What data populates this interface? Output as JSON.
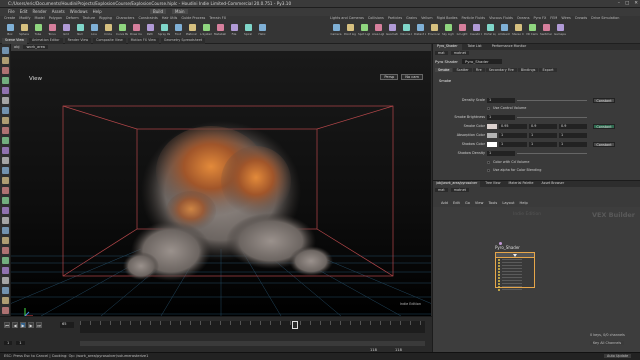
{
  "window": {
    "title": "C:/Users/eric/Documents/HoudiniProjects/ExplosionCourse/ExplosionCourse.hiplc - Houdini Indie Limited-Commercial 20.0.751 - Py3.10",
    "min_glyph": "–",
    "max_glyph": "□",
    "close_glyph": "✕"
  },
  "menubar": {
    "items": [
      "File",
      "Edit",
      "Render",
      "Assets",
      "Windows",
      "Help"
    ],
    "build_label": "Build",
    "desktop_label": "Main"
  },
  "shelf": {
    "left_tabs": [
      "Create",
      "Modify",
      "Model",
      "Polygon",
      "Deform",
      "Texture",
      "Rigging",
      "Characters",
      "Constraints",
      "Hair Utils",
      "Guide Process",
      "Terrain FX",
      "Simple FX",
      "Volume"
    ],
    "right_tabs": [
      "Lights and Cameras",
      "Collisions",
      "Particles",
      "Grains",
      "Vellum",
      "Rigid Bodies",
      "Particle Fluids",
      "Viscous Fluids",
      "Oceans",
      "Pyro FX",
      "FEM",
      "Wires",
      "Crowds",
      "Drive Simulation"
    ],
    "left_tools": [
      "Box",
      "Sphere",
      "Tube",
      "Torus",
      "Grid",
      "Null",
      "Line",
      "Circle",
      "Curve Bezier",
      "Draw Curve",
      "Path",
      "Spray Paint",
      "Font",
      "Platonic Solids",
      "L-System",
      "Metaball",
      "File",
      "Spiral",
      "Helix"
    ],
    "right_tools": [
      "Camera",
      "Point Light",
      "Spot Light",
      "Area Light",
      "Geometry Light",
      "Volume Light",
      "Distant Light",
      "Environment Light",
      "Sky Light",
      "GI Light",
      "Caustic Light",
      "Portal Light",
      "Ambient Light",
      "Stereo Camera",
      "VR Camera",
      "Switcher",
      "Gamepad Camera"
    ],
    "pane_tabs": [
      "Scene View",
      "Animation Editor",
      "Render View",
      "Composite View",
      "Motion FX View",
      "Geometry Spreadsheet"
    ]
  },
  "viewport": {
    "path_root": "obj",
    "path_node": "work_area",
    "label": "View",
    "persp_button": "Persp",
    "cam_button": "No cam",
    "footer": "Indie Edition"
  },
  "timeline": {
    "frame": "65",
    "start": "1",
    "end_field": "1",
    "range_start": "118",
    "range_end": "118",
    "keys_label": "0 keys, 0/0 channels",
    "key_all_label": "Key All Channels",
    "auto_update": "Auto Update"
  },
  "status": {
    "text": "ESC: Press Esc to Cancel | Cooking: Op: /work_area/pyrosolver/volumerasterize1"
  },
  "param_pane": {
    "tabs": [
      "Pyro_Shader",
      "Take List",
      "Performance Monitor"
    ],
    "path_root": "mat",
    "path_node": "matnet",
    "node_type": "Pyro Shader",
    "node_name": "Pyro_Shader",
    "subtabs": [
      "Smoke",
      "Scatter",
      "Fire",
      "Secondary Fire",
      "Bindings",
      "Export"
    ],
    "section": "Smoke",
    "params": {
      "density_scale_label": "Density Scale",
      "density_scale_value": "1",
      "use_control_volume": "Use Control Volume",
      "smoke_brightness_label": "Smoke Brightness",
      "smoke_brightness_value": "1",
      "smoke_color_label": "Smoke Color",
      "smoke_color_values": [
        "0.95",
        "0.9",
        "0.9"
      ],
      "absorption_color_label": "Absorption Color",
      "absorption_color_values": [
        "1",
        "1",
        "1"
      ],
      "shadow_color_label": "Shadow Color",
      "shadow_color_values": [
        "1",
        "1",
        "1"
      ],
      "shadow_density_label": "Shadow Density",
      "shadow_density_value": "1",
      "color_with_cd": "Color with Cd Volume",
      "use_alpha": "Use alpha for Color Blending",
      "constant_label": "Constant"
    },
    "colors": {
      "smoke_swatch": "#dcd2cf",
      "absorption_swatch": "#b4b4b4",
      "shadow_swatch": "#ffffff"
    }
  },
  "network_pane": {
    "tabs": [
      "/obj/work_area/pyrosolver",
      "Tree View",
      "Material Palette",
      "Asset Browser"
    ],
    "path_root": "mat",
    "path_node": "matnet",
    "menu": [
      "Add",
      "Edit",
      "Go",
      "View",
      "Tools",
      "Layout",
      "Help"
    ],
    "context_title": "Indie Edition",
    "vex_title": "VEX Builder",
    "node_name": "Pyro_Shader"
  }
}
